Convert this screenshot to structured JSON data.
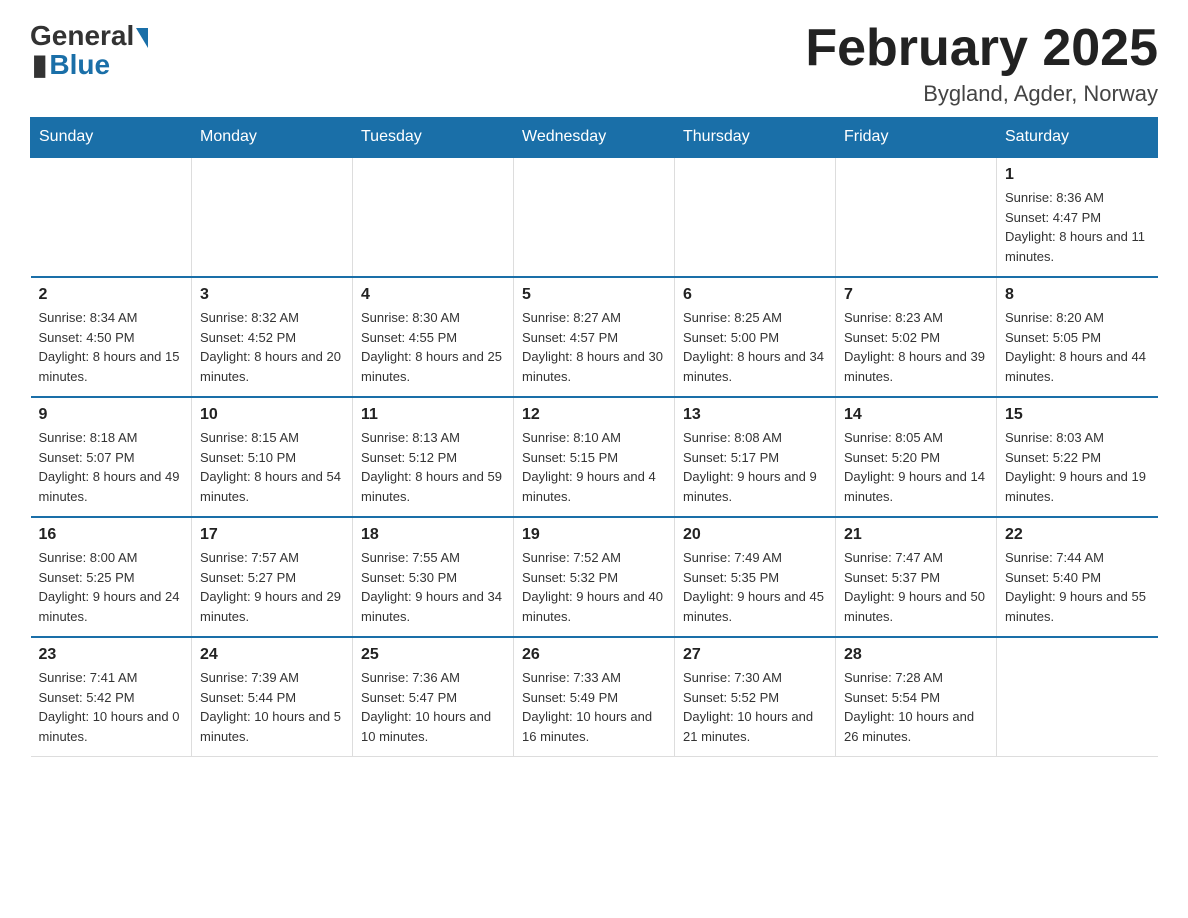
{
  "header": {
    "logo_general": "General",
    "logo_blue": "Blue",
    "month_title": "February 2025",
    "location": "Bygland, Agder, Norway"
  },
  "days_of_week": [
    "Sunday",
    "Monday",
    "Tuesday",
    "Wednesday",
    "Thursday",
    "Friday",
    "Saturday"
  ],
  "weeks": [
    [
      {
        "day": "",
        "info": ""
      },
      {
        "day": "",
        "info": ""
      },
      {
        "day": "",
        "info": ""
      },
      {
        "day": "",
        "info": ""
      },
      {
        "day": "",
        "info": ""
      },
      {
        "day": "",
        "info": ""
      },
      {
        "day": "1",
        "info": "Sunrise: 8:36 AM\nSunset: 4:47 PM\nDaylight: 8 hours and 11 minutes."
      }
    ],
    [
      {
        "day": "2",
        "info": "Sunrise: 8:34 AM\nSunset: 4:50 PM\nDaylight: 8 hours and 15 minutes."
      },
      {
        "day": "3",
        "info": "Sunrise: 8:32 AM\nSunset: 4:52 PM\nDaylight: 8 hours and 20 minutes."
      },
      {
        "day": "4",
        "info": "Sunrise: 8:30 AM\nSunset: 4:55 PM\nDaylight: 8 hours and 25 minutes."
      },
      {
        "day": "5",
        "info": "Sunrise: 8:27 AM\nSunset: 4:57 PM\nDaylight: 8 hours and 30 minutes."
      },
      {
        "day": "6",
        "info": "Sunrise: 8:25 AM\nSunset: 5:00 PM\nDaylight: 8 hours and 34 minutes."
      },
      {
        "day": "7",
        "info": "Sunrise: 8:23 AM\nSunset: 5:02 PM\nDaylight: 8 hours and 39 minutes."
      },
      {
        "day": "8",
        "info": "Sunrise: 8:20 AM\nSunset: 5:05 PM\nDaylight: 8 hours and 44 minutes."
      }
    ],
    [
      {
        "day": "9",
        "info": "Sunrise: 8:18 AM\nSunset: 5:07 PM\nDaylight: 8 hours and 49 minutes."
      },
      {
        "day": "10",
        "info": "Sunrise: 8:15 AM\nSunset: 5:10 PM\nDaylight: 8 hours and 54 minutes."
      },
      {
        "day": "11",
        "info": "Sunrise: 8:13 AM\nSunset: 5:12 PM\nDaylight: 8 hours and 59 minutes."
      },
      {
        "day": "12",
        "info": "Sunrise: 8:10 AM\nSunset: 5:15 PM\nDaylight: 9 hours and 4 minutes."
      },
      {
        "day": "13",
        "info": "Sunrise: 8:08 AM\nSunset: 5:17 PM\nDaylight: 9 hours and 9 minutes."
      },
      {
        "day": "14",
        "info": "Sunrise: 8:05 AM\nSunset: 5:20 PM\nDaylight: 9 hours and 14 minutes."
      },
      {
        "day": "15",
        "info": "Sunrise: 8:03 AM\nSunset: 5:22 PM\nDaylight: 9 hours and 19 minutes."
      }
    ],
    [
      {
        "day": "16",
        "info": "Sunrise: 8:00 AM\nSunset: 5:25 PM\nDaylight: 9 hours and 24 minutes."
      },
      {
        "day": "17",
        "info": "Sunrise: 7:57 AM\nSunset: 5:27 PM\nDaylight: 9 hours and 29 minutes."
      },
      {
        "day": "18",
        "info": "Sunrise: 7:55 AM\nSunset: 5:30 PM\nDaylight: 9 hours and 34 minutes."
      },
      {
        "day": "19",
        "info": "Sunrise: 7:52 AM\nSunset: 5:32 PM\nDaylight: 9 hours and 40 minutes."
      },
      {
        "day": "20",
        "info": "Sunrise: 7:49 AM\nSunset: 5:35 PM\nDaylight: 9 hours and 45 minutes."
      },
      {
        "day": "21",
        "info": "Sunrise: 7:47 AM\nSunset: 5:37 PM\nDaylight: 9 hours and 50 minutes."
      },
      {
        "day": "22",
        "info": "Sunrise: 7:44 AM\nSunset: 5:40 PM\nDaylight: 9 hours and 55 minutes."
      }
    ],
    [
      {
        "day": "23",
        "info": "Sunrise: 7:41 AM\nSunset: 5:42 PM\nDaylight: 10 hours and 0 minutes."
      },
      {
        "day": "24",
        "info": "Sunrise: 7:39 AM\nSunset: 5:44 PM\nDaylight: 10 hours and 5 minutes."
      },
      {
        "day": "25",
        "info": "Sunrise: 7:36 AM\nSunset: 5:47 PM\nDaylight: 10 hours and 10 minutes."
      },
      {
        "day": "26",
        "info": "Sunrise: 7:33 AM\nSunset: 5:49 PM\nDaylight: 10 hours and 16 minutes."
      },
      {
        "day": "27",
        "info": "Sunrise: 7:30 AM\nSunset: 5:52 PM\nDaylight: 10 hours and 21 minutes."
      },
      {
        "day": "28",
        "info": "Sunrise: 7:28 AM\nSunset: 5:54 PM\nDaylight: 10 hours and 26 minutes."
      },
      {
        "day": "",
        "info": ""
      }
    ]
  ]
}
